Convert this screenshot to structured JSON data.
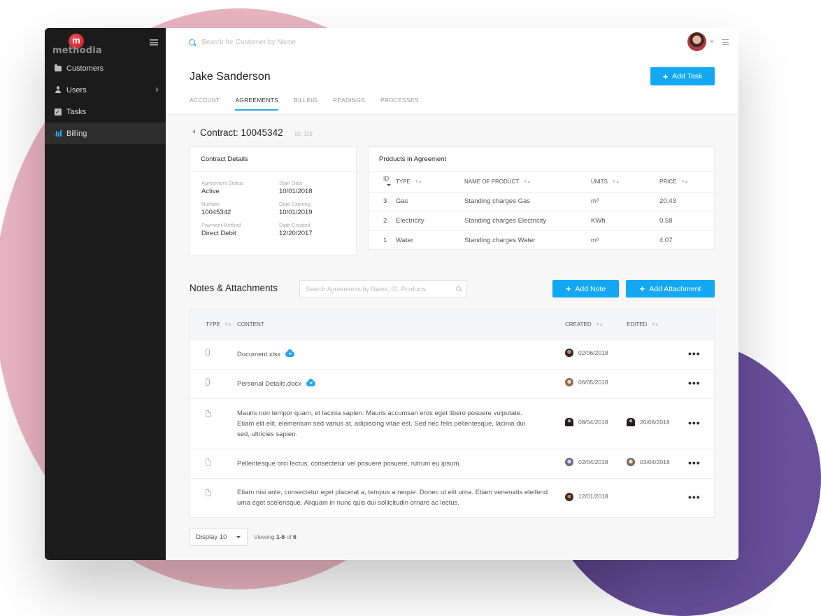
{
  "brand": {
    "name": "methodia",
    "logo_letter": "m",
    "accent_color": "#13a8f2",
    "sidebar_bg": "#1c1b1c"
  },
  "sidebar": {
    "items": [
      {
        "label": "Customers",
        "icon": "folder-icon",
        "active": false,
        "has_submenu": false
      },
      {
        "label": "Users",
        "icon": "user-icon",
        "active": false,
        "has_submenu": true
      },
      {
        "label": "Tasks",
        "icon": "checkbox-icon",
        "active": false,
        "has_submenu": false
      },
      {
        "label": "Billing",
        "icon": "bar-chart-icon",
        "active": true,
        "has_submenu": false
      }
    ]
  },
  "topbar": {
    "search_placeholder": "Search for Customer by Name"
  },
  "header": {
    "title": "Jake Sanderson",
    "add_task_label": "Add Task",
    "tabs": [
      {
        "label": "ACCOUNT",
        "active": false
      },
      {
        "label": "AGREEMENTS",
        "active": true
      },
      {
        "label": "BILLING",
        "active": false
      },
      {
        "label": "READINGS",
        "active": false
      },
      {
        "label": "PROCESSES",
        "active": false
      }
    ]
  },
  "contract": {
    "title": "Contract: 10045342",
    "id_label": "ID: 119",
    "details_title": "Contract Details",
    "fields": [
      {
        "label": "Agreement Status",
        "value": "Active"
      },
      {
        "label": "Start Date",
        "value": "10/01/2018"
      },
      {
        "label": "Number",
        "value": "10045342"
      },
      {
        "label": "Date Expiring",
        "value": "10/01/2019"
      },
      {
        "label": "Payment Method",
        "value": "Direct Debit"
      },
      {
        "label": "Date Created",
        "value": "12/20/2017"
      }
    ]
  },
  "products": {
    "title": "Products in Agreement",
    "columns": [
      "ID",
      "TYPE",
      "NAME OF PRODUCT",
      "UNITS",
      "PRICE"
    ],
    "rows": [
      {
        "id": "3",
        "type": "Gas",
        "name": "Standing charges Gas",
        "units": "m³",
        "price": "20.43"
      },
      {
        "id": "2",
        "type": "Electricity",
        "name": "Standing charges Electricity",
        "units": "KWh",
        "price": "0.58"
      },
      {
        "id": "1",
        "type": "Water",
        "name": "Standing charges Water",
        "units": "m³",
        "price": "4.07"
      }
    ]
  },
  "notes": {
    "title": "Notes & Attachments",
    "search_placeholder": "Search Agreements by Name, ID, Products",
    "add_note_label": "Add Note",
    "add_attachment_label": "Add Attachment",
    "columns": [
      "TYPE",
      "CONTENT",
      "CREATED",
      "EDITED"
    ],
    "rows": [
      {
        "type": "attachment",
        "content": "Document.xlsx",
        "downloadable": true,
        "created": "02/06/2018",
        "edited": ""
      },
      {
        "type": "attachment",
        "content": "Personal Details.docx",
        "downloadable": true,
        "created": "06/05/2018",
        "edited": ""
      },
      {
        "type": "note",
        "content": "Mauris non tempor quam, et lacinia sapien. Mauris accumsan eros eget libero posuere vulputate. Etiam elit elit, elementum sed varius at, adipiscing vitae est. Sed nec felis pellentesque, lacinia dui sed, ultricies sapien.",
        "downloadable": false,
        "created": "08/04/2018",
        "edited": "20/06/2018"
      },
      {
        "type": "note",
        "content": "Pellentesque orci lectus, consectetur vel posuere posuere, rutrum eu ipsum.",
        "downloadable": false,
        "created": "02/04/2018",
        "edited": "03/04/2018"
      },
      {
        "type": "note",
        "content": "Etiam nisi ante, consectetur eget placerat a, tempus a neque. Donec ut elit urna. Etiam venenatis eleifend urna eget scelerisque. Aliquam in nunc quis dui sollicitudin ornare ac lectus.",
        "downloadable": false,
        "created": "12/01/2018",
        "edited": ""
      }
    ],
    "row_action_icon": "more-dots-icon"
  },
  "pagination": {
    "display_label": "Display 10",
    "viewing_prefix": "Viewing",
    "viewing_range": "1-6",
    "viewing_of": "of",
    "viewing_total": "6"
  }
}
